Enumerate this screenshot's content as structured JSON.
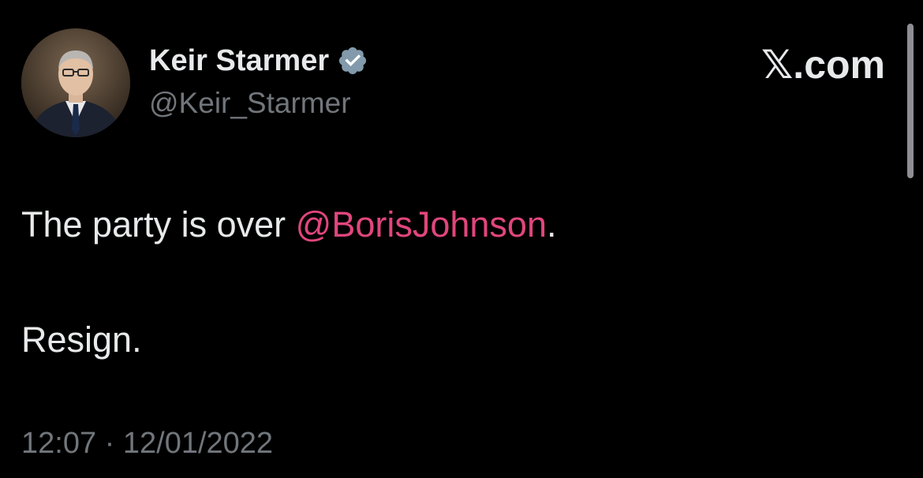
{
  "tweet": {
    "author": {
      "display_name": "Keir Starmer",
      "handle": "@Keir_Starmer",
      "verified": true,
      "verified_icon": "verified-badge-icon",
      "avatar": "profile-photo"
    },
    "brand": "𝕏.com",
    "text": {
      "line1_prefix": "The party is over ",
      "mention": "@BorisJohnson",
      "line1_suffix": ".",
      "line2": "Resign."
    },
    "timestamp": "12:07 · 12/01/2022"
  },
  "colors": {
    "background": "#000000",
    "primary_text": "#e7e9ea",
    "secondary_text": "#71767b",
    "mention": "#e0467c",
    "verified_badge": "#829aab"
  }
}
